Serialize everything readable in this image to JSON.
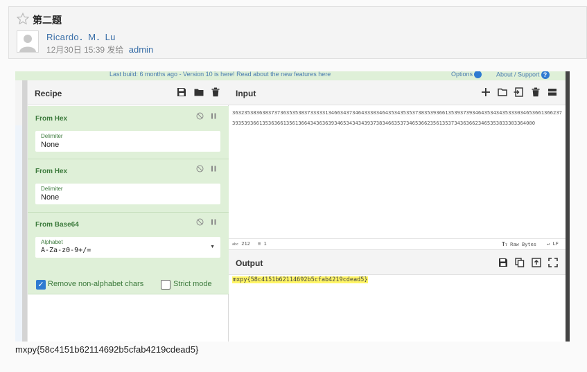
{
  "post": {
    "title": "第二题",
    "author": "Ricardo．M．Lu",
    "date": "12月30日 15:39",
    "by_label": "发给",
    "by_user": "admin"
  },
  "cyberchef": {
    "banner_text": "Last build: 6 months ago - Version 10 is here! Read about the new features here",
    "options_label": "Options",
    "about_label": "About / Support",
    "recipe_title": "Recipe",
    "operations": [
      {
        "name": "From Hex",
        "field_label": "Delimiter",
        "field_value": "None"
      },
      {
        "name": "From Hex",
        "field_label": "Delimiter",
        "field_value": "None"
      },
      {
        "name": "From Base64",
        "field_label": "Alphabet",
        "field_value": "A-Za-z0-9+/="
      }
    ],
    "remove_nonalpha_label": "Remove non-alphabet chars",
    "strict_mode_label": "Strict mode",
    "input_title": "Input",
    "input_text": "3632353836383737363535383733333134663437346433303464353435353738353936613539373934643534343533303465366136623739353936613536366135613664343636393465343434393738346635373465366235613537343636623465353833303364000",
    "status_chars_label": "abc",
    "status_chars": "212",
    "status_lines": "1",
    "status_format": "Raw Bytes",
    "status_eol": "LF",
    "output_title": "Output",
    "output_text": "mxpy{58c4151b62114692b5cfab4219cdead5}"
  },
  "answer": "mxpy{58c4151b62114692b5cfab4219cdead5}",
  "colors": {
    "op_bg": "#dff0d8",
    "op_text": "#3c7a3c",
    "link": "#3a6fa8",
    "highlight": "#fff566"
  }
}
